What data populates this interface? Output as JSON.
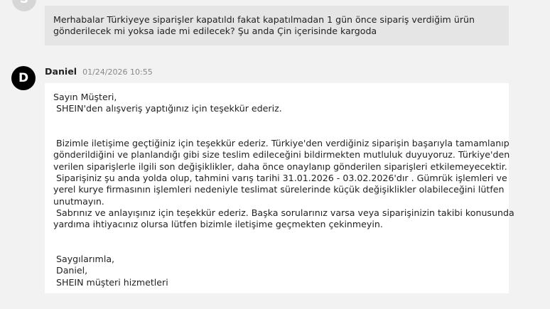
{
  "user_message": {
    "avatar_letter": "S",
    "text_lines": [
      "Merhabalar Türkiyeye siparişler kapatıldı fakat kapatılmadan 1 gün önce sipariş verdiğim ürün",
      "gönderilecek mi yoksa iade mi edilecek? Şu anda Çin içerisinde kargoda"
    ]
  },
  "agent_message": {
    "avatar_letter": "D",
    "name": "Daniel",
    "timestamp": "01/24/2026 10:55",
    "lines": {
      "l1": "Sayın Müşteri,",
      "l2": " SHEIN'den alışveriş yaptığınız için teşekkür ederiz.",
      "l5": " Bizimle iletişime geçtiğiniz için teşekkür ederiz. Türkiye'den verdiğiniz siparişin başarıyla tamamlanıp",
      "l6": "gönderildiğini ve planlandığı gibi size teslim edileceğini bildirmekten mutluluk duyuyoruz. Türkiye'den",
      "l7": "verilen siparişlerle ilgili son değişiklikler, daha önce onaylanıp gönderilen siparişleri etkilemeyecektir.",
      "l8": " Siparişiniz şu anda yolda olup, tahmini varış tarihi 31.01.2026 - 03.02.2026'dır . Gümrük işlemleri ve",
      "l9": "yerel kurye firmasının işlemleri nedeniyle teslimat sürelerinde küçük değişiklikler olabileceğini lütfen",
      "l10": "unutmayın.",
      "l11": " Sabrınız ve anlayışınız için teşekkür ederiz. Başka sorularınız varsa veya siparişinizin takibi konusunda",
      "l12": "yardıma ihtiyacınız olursa lütfen bizimle iletişime geçmekten çekinmeyin.",
      "l15": " Saygılarımla,",
      "l16": " Daniel,",
      "l17": " SHEIN müşteri hizmetleri"
    }
  }
}
